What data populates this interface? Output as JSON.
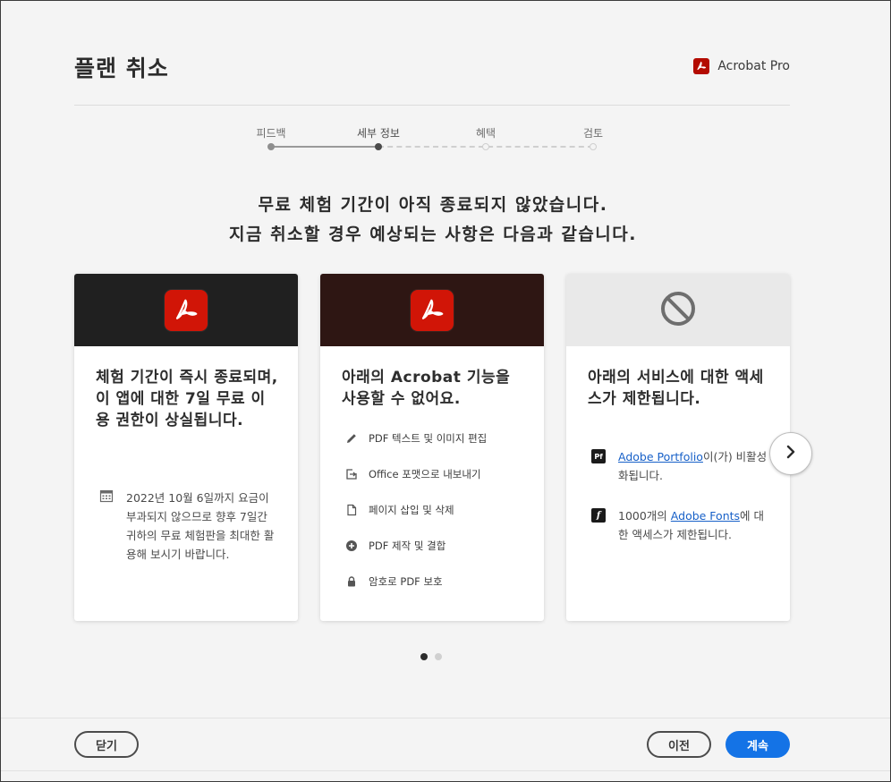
{
  "header": {
    "title": "플랜 취소",
    "product_name": "Acrobat Pro"
  },
  "stepper": {
    "steps": [
      {
        "label": "피드백",
        "state": "done"
      },
      {
        "label": "세부 정보",
        "state": "current"
      },
      {
        "label": "혜택",
        "state": "todo"
      },
      {
        "label": "검토",
        "state": "todo"
      }
    ]
  },
  "headline": {
    "line1": "무료 체험 기간이 아직 종료되지 않았습니다.",
    "line2": "지금 취소할 경우 예상되는 사항은 다음과 같습니다."
  },
  "cards": [
    {
      "title": "체험 기간이 즉시 종료되며, 이 앱에 대한 7일 무료 이용 권한이 상실됩니다.",
      "note": "2022년 10월 6일까지 요금이 부과되지 않으므로 향후 7일간 귀하의 무료 체험판을 최대한 활용해 보시기 바랍니다."
    },
    {
      "title": "아래의 Acrobat 기능을 사용할 수 없어요.",
      "features": [
        {
          "icon": "pencil-icon",
          "label": "PDF 텍스트 및 이미지 편집"
        },
        {
          "icon": "export-icon",
          "label": "Office 포맷으로 내보내기"
        },
        {
          "icon": "page-icon",
          "label": "페이지 삽입 및 삭제"
        },
        {
          "icon": "plus-circle-icon",
          "label": "PDF 제작 및 결합"
        },
        {
          "icon": "lock-icon",
          "label": "암호로 PDF 보호"
        }
      ]
    },
    {
      "title": "아래의 서비스에 대한 액세스가 제한됩니다.",
      "services": [
        {
          "icon": "Pf",
          "link": "Adobe Portfolio",
          "text": "이(가) 비활성화됩니다."
        },
        {
          "icon": "f",
          "pre": "1000개의 ",
          "link": "Adobe Fonts",
          "text": "에 대한 액세스가 제한됩니다."
        }
      ]
    }
  ],
  "pager": {
    "count": 2,
    "active": 0
  },
  "footer": {
    "close_label": "닫기",
    "prev_label": "이전",
    "continue_label": "계속"
  },
  "colors": {
    "accent": "#1473e6",
    "acrobat_red": "#d11507",
    "card1_header": "#202020",
    "card2_header": "#2e1613",
    "card3_header": "#e9e9e9"
  }
}
